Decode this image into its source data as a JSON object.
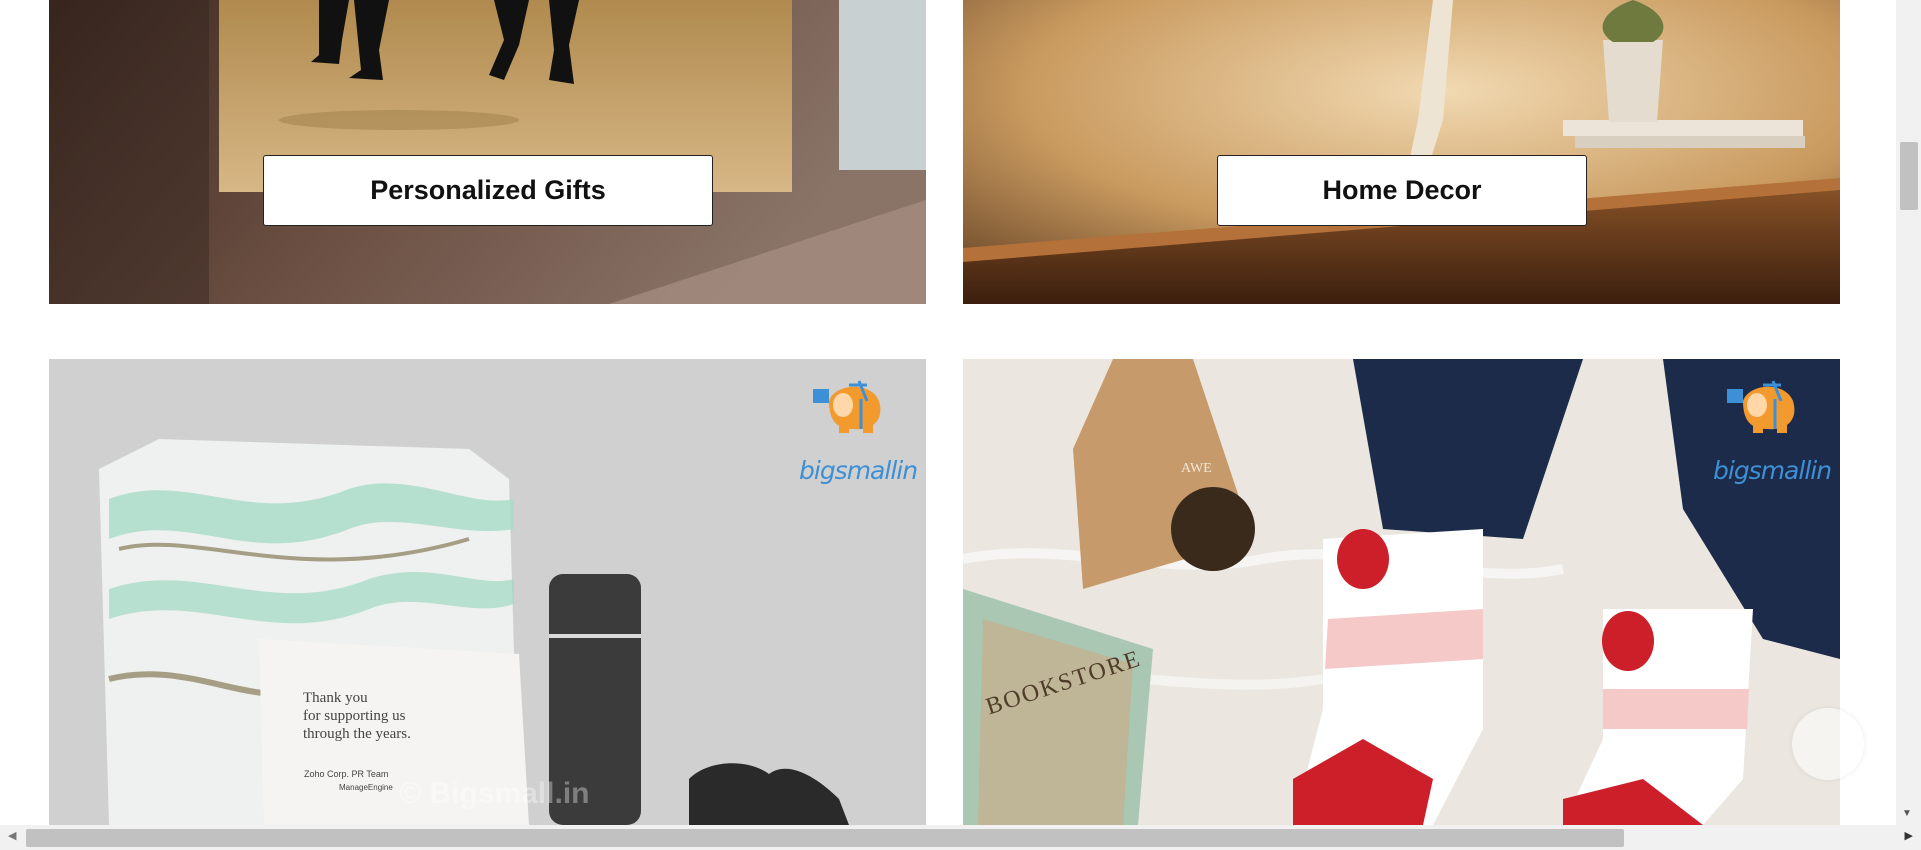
{
  "categories": {
    "personalized_gifts": "Personalized Gifts",
    "home_decor": "Home Decor"
  },
  "brand": {
    "logo_text": "bigsmallin"
  },
  "product_card": {
    "line1": "Thank you",
    "line2": "for supporting us",
    "line3": "through the years.",
    "signature": "Zoho Corp. PR Team",
    "brands": "ManageEngine"
  },
  "socks_scene": {
    "tent_text": "AWE",
    "book_text": "BOOKSTORE"
  },
  "watermark": "© Bigsmall.in",
  "colors": {
    "accent_logo": "#3d8fd6",
    "logo_elephant": "#f29a2e",
    "button_bg": "#ffffff",
    "button_border": "#222222"
  }
}
